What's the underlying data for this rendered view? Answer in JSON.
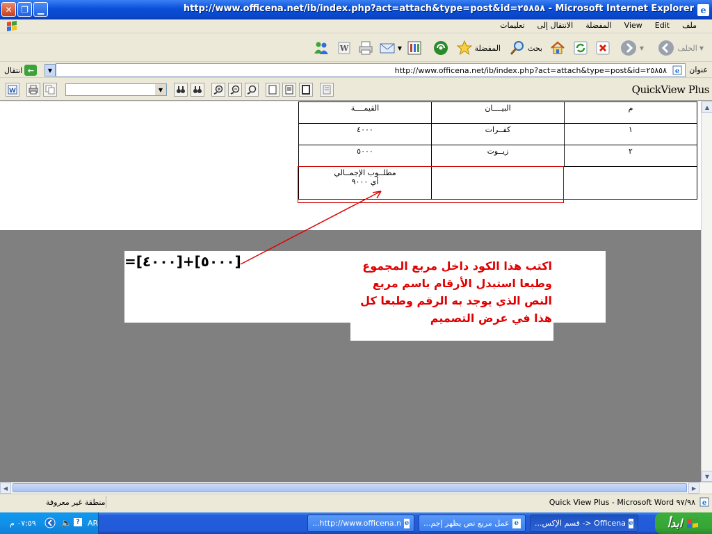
{
  "window": {
    "title": "http://www.officena.net/ib/index.php?act=attach&type=post&id=٢٥٨٥٨ - Microsoft Internet Explorer"
  },
  "menu": {
    "items": [
      "ملف",
      "Edit",
      "View",
      "المفضلة",
      "الانتقال إلى",
      "تعليمات"
    ]
  },
  "toolbar": {
    "back": "الخلف",
    "search": "بحث",
    "favorites": "المفضلة"
  },
  "address": {
    "label": "عنوان",
    "url": "http://www.officena.net/ib/index.php?act=attach&type=post&id=٢٥٨٥٨",
    "go": "انتقال"
  },
  "quickview": {
    "title": "QuickView Plus",
    "font_value": ""
  },
  "document": {
    "table": {
      "rows": [
        [
          "م",
          "البيــــان",
          "القيمــــة"
        ],
        [
          "١",
          "كفــرات",
          "٤٠٠٠"
        ],
        [
          "٢",
          "زيــوت",
          "٥٠٠٠"
        ]
      ],
      "total_label_line1": "مطلــوب الإجمــالي",
      "total_label_line2": "أي ٩٠٠٠"
    },
    "formula": "=[٤٠٠٠]+[٥٠٠٠]",
    "note_lines": [
      "اكتب هذا الكود داخل مربع المجموع",
      "وطبعا استبدل الأرقام باسم مربع",
      "النص الذي يوجد به الرقم وطبعا كل",
      "هذا في عرض التصميم"
    ]
  },
  "status": {
    "left": "منطقة غير معروفة",
    "right": "Quick View Plus - Microsoft Word ٩٧/٩٨"
  },
  "taskbar": {
    "start": "ابدأ",
    "tasks": [
      "Officena <- قسم الإكس...",
      "عمل مربع نص يظهر إجم...",
      "http://www.officena.n..."
    ],
    "lang": "AR",
    "clock": "٠٧:٥٩ م"
  },
  "colors": {
    "annotation_red": "#e00000",
    "title_blue": "#0a4fd8"
  }
}
